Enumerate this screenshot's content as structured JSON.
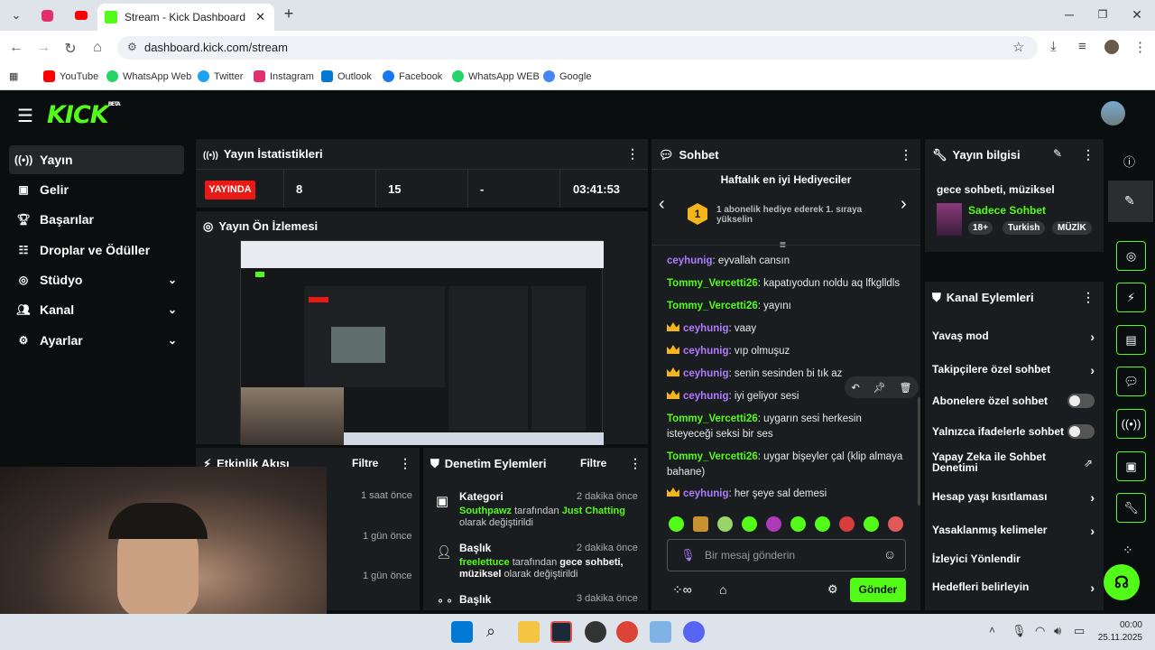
{
  "browser": {
    "tab_title": "Stream - Kick Dashboard",
    "url": "dashboard.kick.com/stream",
    "bookmarks": [
      "YouTube",
      "WhatsApp Web",
      "Twitter",
      "Instagram",
      "Outlook",
      "Facebook",
      "WhatsApp WEB",
      "Google"
    ]
  },
  "logo": {
    "text": "KICK",
    "beta": "BETA"
  },
  "sidebar": {
    "items": [
      {
        "label": "Yayın"
      },
      {
        "label": "Gelir"
      },
      {
        "label": "Başarılar"
      },
      {
        "label": "Droplar ve Ödüller"
      },
      {
        "label": "Stüdyo"
      },
      {
        "label": "Kanal"
      },
      {
        "label": "Ayarlar"
      }
    ]
  },
  "stats": {
    "title": "Yayın İstatistikleri",
    "live_badge": "YAYINDA",
    "values": [
      "8",
      "15",
      "-",
      "03:41:53"
    ]
  },
  "preview": {
    "title": "Yayın Ön İzlemesi"
  },
  "activity": {
    "title": "Etkinlik Akışı",
    "filter": "Filtre",
    "times": [
      "1 saat önce",
      "1 gün önce",
      "1 gün önce"
    ]
  },
  "moderation": {
    "title": "Denetim Eylemleri",
    "filter": "Filtre",
    "items": [
      {
        "title": "Kategori",
        "time": "2 dakika önce",
        "user": "Southpawz",
        "mid": " tarafından ",
        "value": "Just Chatting",
        "tail": "olarak değiştirildi"
      },
      {
        "title": "Başlık",
        "time": "2 dakika önce",
        "user": "freelettuce",
        "mid": " tarafından ",
        "value": "gece sohbeti, müziksel",
        "tail": " olarak değiştirildi"
      },
      {
        "title": "Başlık",
        "time": "3 dakika önce"
      }
    ]
  },
  "chat": {
    "title": "Sohbet",
    "gifters_title": "Haftalık en iyi Hediyeciler",
    "gifters_rank": "1",
    "gifters_text": "1 abonelik hediye ederek 1. sıraya yükselin",
    "messages": [
      {
        "user": "ceyhunig",
        "text": ": eyvallah cansın"
      },
      {
        "user": "Tommy_Vercetti26",
        "text": ": kapatıyodun noldu aq lfkglldls"
      },
      {
        "user": "Tommy_Vercetti26",
        "text": ": yayını"
      },
      {
        "user": "ceyhunig",
        "text": ": vaay"
      },
      {
        "user": "ceyhunig",
        "text": ": vıp olmuşuz"
      },
      {
        "user": "ceyhunig",
        "text": ": senin sesinden bi tık az"
      },
      {
        "user": "ceyhunig",
        "text": ": iyi geliyor sesi"
      },
      {
        "user": "Tommy_Vercetti26",
        "text": ": uygarın sesi herkesin isteyeceği seksi bir ses"
      },
      {
        "user": "Tommy_Vercetti26",
        "text": ": uygar bişeyler çal (klip almaya bahane)"
      },
      {
        "user": "ceyhunig",
        "text": ": her şeye sal demesi"
      }
    ],
    "placeholder": "Bir mesaj gönderin",
    "send": "Gönder"
  },
  "stream_info": {
    "title": "Yayın bilgisi",
    "stream_title": "gece sohbeti, müziksel",
    "category": "Sadece Sohbet",
    "tags": [
      "18+",
      "Turkish",
      "MÜZİK"
    ]
  },
  "channel_actions": {
    "title": "Kanal Eylemleri",
    "rows": [
      "Yavaş mod",
      "Takipçilere özel sohbet",
      "Abonelere özel sohbet",
      "Yalnızca ifadelerle sohbet",
      "Yapay Zeka ile Sohbet Denetimi",
      "Hesap yaşı kısıtlaması",
      "Yasaklanmış kelimeler",
      "İzleyici Yönlendir",
      "Hedefleri belirleyin"
    ]
  },
  "taskbar": {
    "time": "00:00",
    "date": "25.11.2025"
  },
  "colors": {
    "accent": "#53fc18",
    "live": "#e91916",
    "bg": "#0b0e0f",
    "panel": "#1a1d1f"
  }
}
